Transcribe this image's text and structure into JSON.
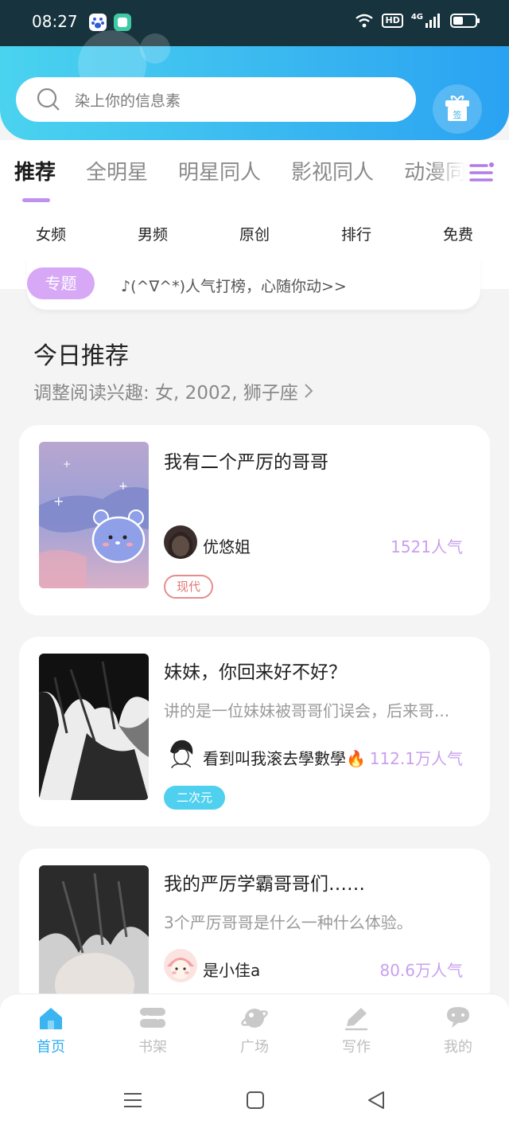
{
  "status_bar": {
    "time": "08:27",
    "hd_label": "HD",
    "network_label": "4G",
    "battery_level": 0.45
  },
  "search": {
    "placeholder": "染上你的信息素"
  },
  "gift": {
    "label": "签"
  },
  "category_tabs": [
    {
      "label": "推荐",
      "active": true
    },
    {
      "label": "全明星",
      "active": false
    },
    {
      "label": "明星同人",
      "active": false
    },
    {
      "label": "影视同人",
      "active": false
    },
    {
      "label": "动漫同",
      "active": false
    }
  ],
  "sub_tabs": [
    "女频",
    "男频",
    "原创",
    "排行",
    "免费"
  ],
  "banner": {
    "tag": "专题",
    "text": "♪(^∇^*)人气打榜，心随你动>>"
  },
  "recommend": {
    "title": "今日推荐",
    "subtitle": "调整阅读兴趣: 女, 2002, 狮子座"
  },
  "books": [
    {
      "title": "我有二个严厉的哥哥",
      "desc": "",
      "author": "优悠姐",
      "popularity": "1521人气",
      "tag": "现代",
      "tag_color": "#e58d8d"
    },
    {
      "title": "妹妹，你回来好不好？",
      "desc": "讲的是一位妹妹被哥哥们误会，后来哥...",
      "author": "看到叫我滚去學數學🔥",
      "popularity": "112.1万人气",
      "tag": "二次元",
      "tag_color": "#4fd0ef"
    },
    {
      "title": "我的严厉学霸哥哥们……",
      "desc": "3个严厉哥哥是什么一种什么体验。",
      "author": "是小佳a",
      "popularity": "80.6万人气",
      "tag": "",
      "tag_color": ""
    }
  ],
  "bottom_nav": [
    {
      "label": "首页",
      "icon": "home-icon",
      "active": true
    },
    {
      "label": "书架",
      "icon": "bookshelf-icon",
      "active": false
    },
    {
      "label": "广场",
      "icon": "planet-icon",
      "active": false
    },
    {
      "label": "写作",
      "icon": "pen-icon",
      "active": false
    },
    {
      "label": "我的",
      "icon": "chat-icon",
      "active": false
    }
  ],
  "colors": {
    "accent": "#2eaef0",
    "purple": "#c191ef",
    "header_start": "#4ad3ef",
    "header_end": "#2aa2f2"
  }
}
